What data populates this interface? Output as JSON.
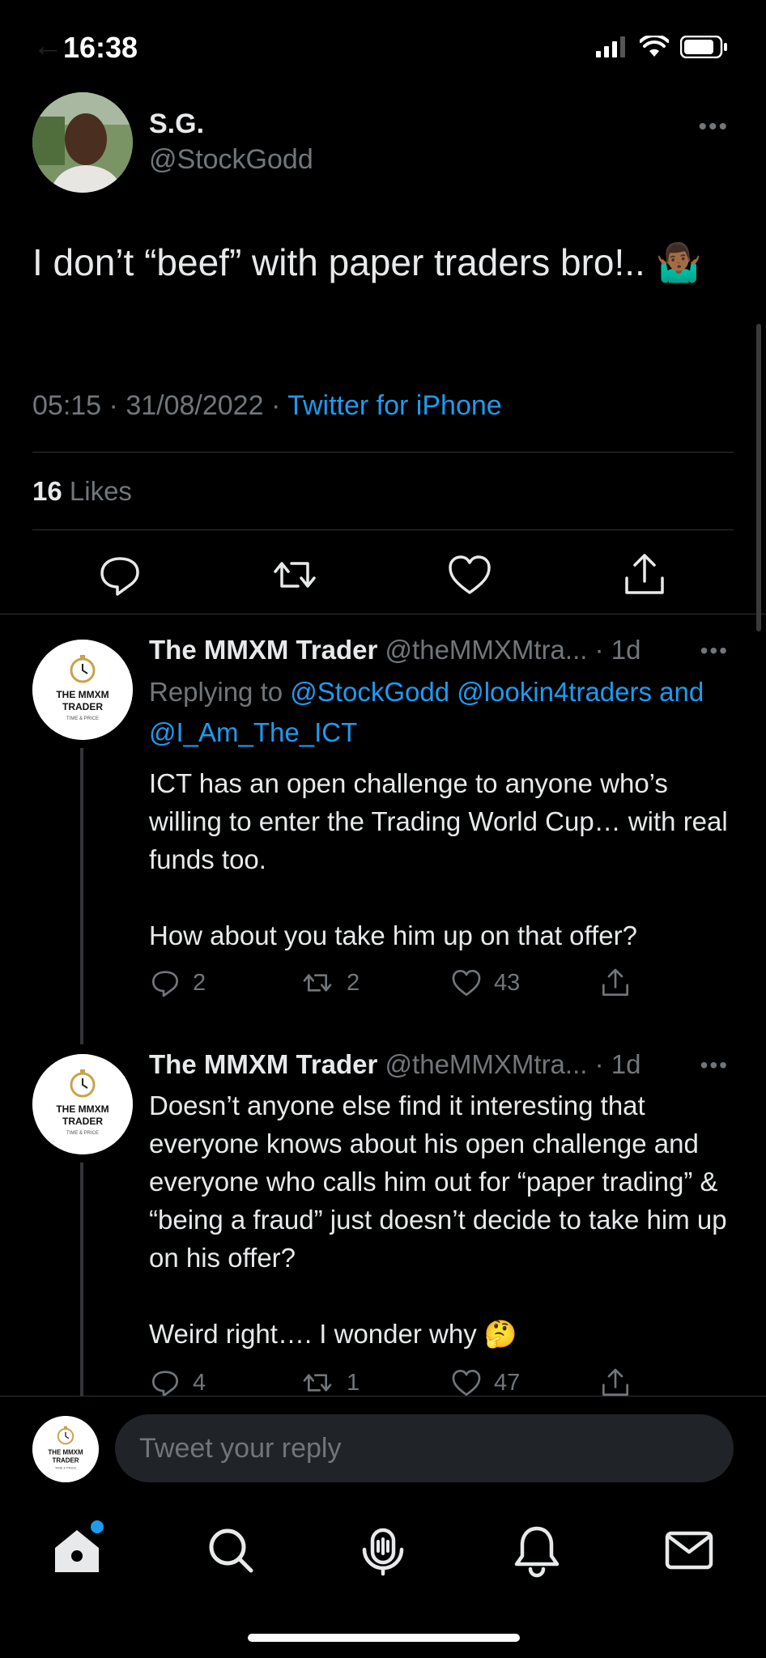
{
  "status_bar": {
    "time": "16:38"
  },
  "main_tweet": {
    "author_name": "S.G.",
    "author_handle": "@StockGodd",
    "text": "I don’t “beef” with paper traders bro!.. 🤷🏾‍♂️",
    "time": "05:15",
    "date": "31/08/2022",
    "source": "Twitter for iPhone",
    "likes_count": "16",
    "likes_label": "Likes"
  },
  "replies": [
    {
      "author_name": "The MMXM Trader",
      "author_handle": "@theMMXMtra...",
      "age": "1d",
      "replying_to_label": "Replying to",
      "mentions": [
        "@StockGodd",
        "@lookin4traders",
        "@I_Am_The_ICT"
      ],
      "and_label": "and",
      "body": "ICT has an open challenge to anyone who’s willing to enter the Trading World Cup… with real funds too.\n\nHow about you take him up on that offer?",
      "reply_count": "2",
      "retweet_count": "2",
      "like_count": "43"
    },
    {
      "author_name": "The MMXM Trader",
      "author_handle": "@theMMXMtra...",
      "age": "1d",
      "body": "Doesn’t anyone else find it interesting that everyone knows about his open challenge and everyone who calls him out for “paper trading” & “being a fraud” just doesn’t decide to take him up on his offer?\n\nWeird right…. I wonder why 🤔",
      "reply_count": "4",
      "retweet_count": "1",
      "like_count": "47"
    }
  ],
  "avatar_logo": {
    "line1": "THE MMXM",
    "line2": "TRADER",
    "line3": "TIME & PRICE"
  },
  "reply_bar": {
    "placeholder": "Tweet your reply"
  },
  "tab_bar": {
    "items": [
      "home-icon",
      "search-icon",
      "spaces-icon",
      "notifications-icon",
      "messages-icon"
    ]
  },
  "colors": {
    "background": "#000000",
    "text_primary": "#e7e9ea",
    "text_secondary": "#71767b",
    "accent": "#1d9bf0",
    "divider": "#2f3336"
  }
}
